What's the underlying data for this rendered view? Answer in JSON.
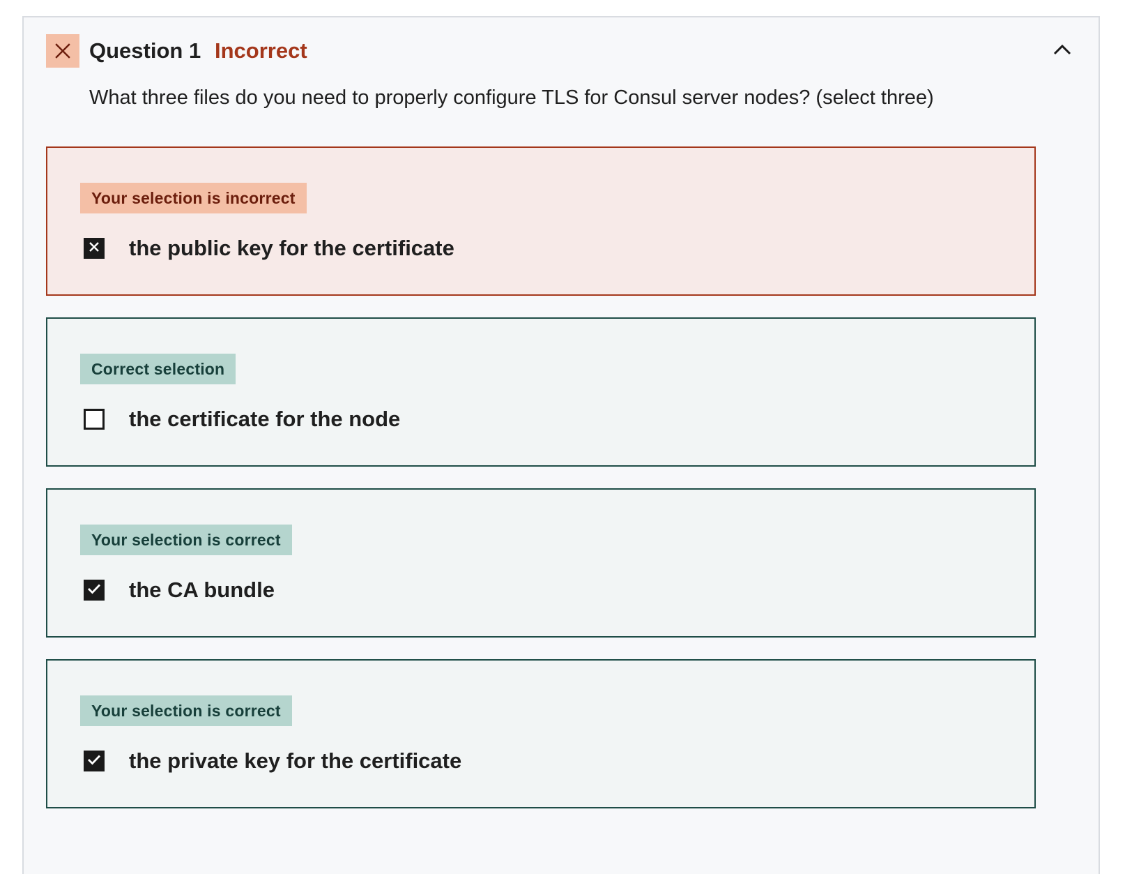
{
  "question": {
    "title": "Question 1",
    "result": "Incorrect",
    "prompt": "What three files do you need to properly configure TLS for Consul server nodes? (select three)"
  },
  "options": [
    {
      "badge": "Your selection is incorrect",
      "label": "the public key for the certificate",
      "state": "selected-incorrect"
    },
    {
      "badge": "Correct selection",
      "label": "the certificate for the node",
      "state": "missed-correct"
    },
    {
      "badge": "Your selection is correct",
      "label": "the CA bundle",
      "state": "selected-correct"
    },
    {
      "badge": "Your selection is correct",
      "label": "the private key for the certificate",
      "state": "selected-correct"
    }
  ],
  "icons": {
    "status": "close-icon",
    "collapse": "chevron-up-icon",
    "incorrect_check": "x-mark-icon",
    "correct_check": "checkmark-icon"
  },
  "colors": {
    "incorrect_accent": "#a4371b",
    "incorrect_badge": "#f4bfa6",
    "correct_border": "#1f4d47",
    "correct_badge": "#b5d5ce"
  }
}
